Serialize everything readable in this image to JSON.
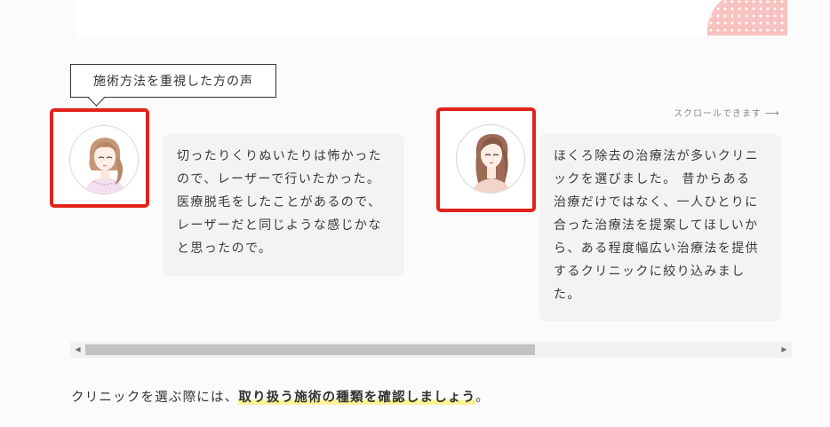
{
  "section_label": "施術方法を重視した方の声",
  "scroll_hint": {
    "text": "スクロールできます",
    "arrow": "⟶"
  },
  "reviews": [
    {
      "avatar": "woman-side-ponytail-illustration",
      "text": "切ったりくりぬいたりは怖かった\nので、レーザーで行いたかった。\n医療脱毛をしたことがあるので、\nレーザーだと同じような感じかな\nと思ったので。"
    },
    {
      "avatar": "woman-long-hair-illustration",
      "text": "ほくろ除去の治療法が多いクリニ\nックを選びました。 昔からある\n治療だけではなく、一人ひとりに\n合った治療法を提案してほしいか\nら、ある程度幅広い治療法を提供\nするクリニックに絞り込みまし\nた。"
    }
  ],
  "horizontal_scrollbar": {
    "left_arrow": "◀",
    "right_arrow": "▶"
  },
  "conclusion": {
    "lead": "クリニックを選ぶ際には、",
    "emphasis": "取り扱う施術の種類を確認しましょう",
    "tail": "。"
  },
  "colors": {
    "highlight_frame": "#e0231b",
    "bubble_bg": "#f3f3f3",
    "marker_yellow": "#fdf39a",
    "dots_pink": "#f8c2c0"
  }
}
